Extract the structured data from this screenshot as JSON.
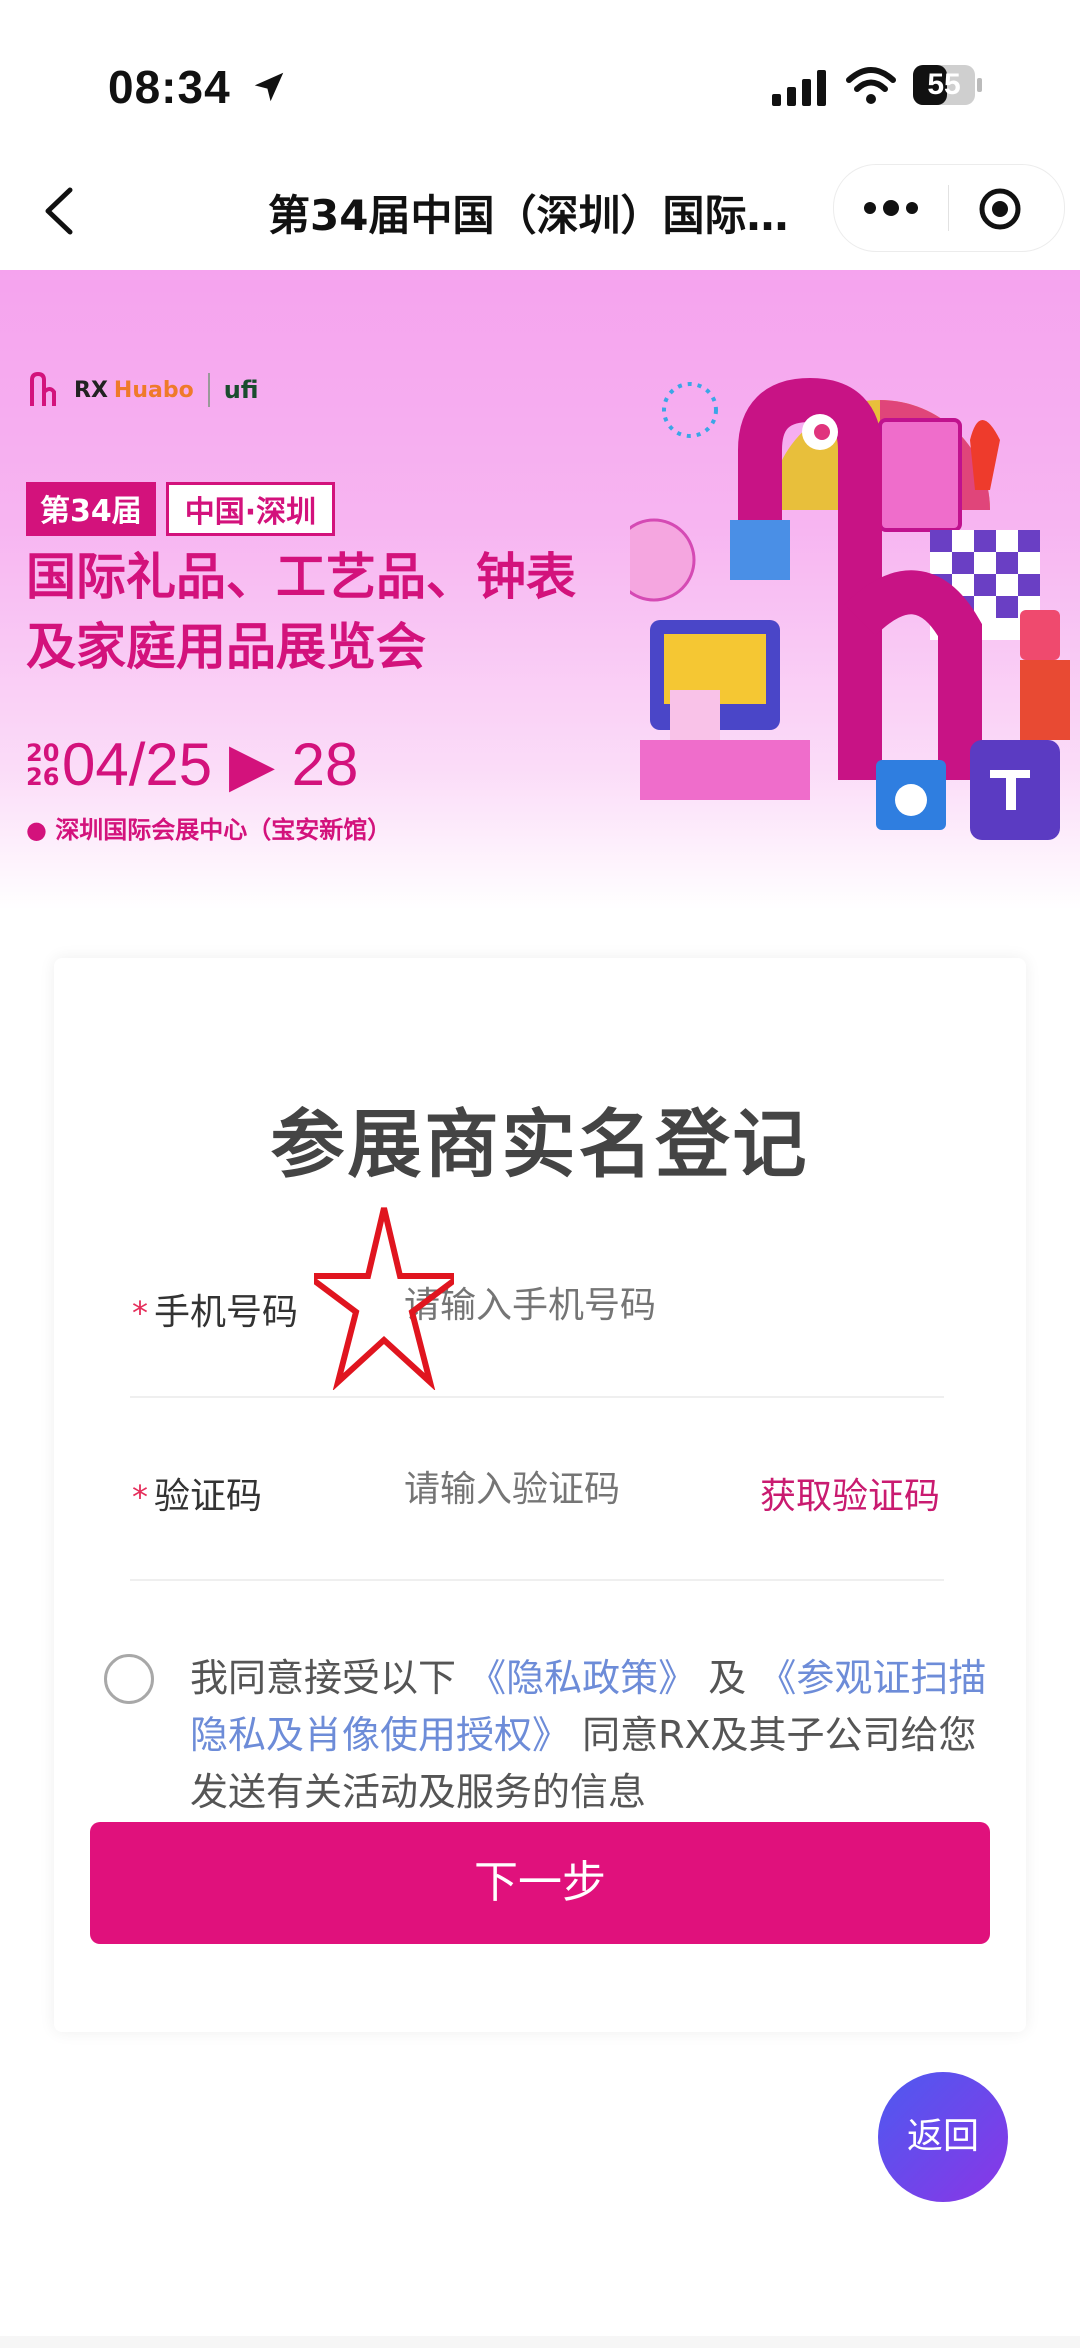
{
  "status_bar": {
    "time": "08:34",
    "battery": "55"
  },
  "nav": {
    "title": "第34届中国（深圳）国际…"
  },
  "banner": {
    "brand": "Huabo",
    "brand_prefix": "RX",
    "partner": "ufi",
    "edition": "第34届",
    "location_tag": "中国·深圳",
    "title_line1": "国际礼品、工艺品、钟表",
    "title_line2": "及家庭用品展览会",
    "year": "20 26",
    "dates": "04/25 ▶ 28",
    "venue": "深圳国际会展中心（宝安新馆）"
  },
  "form": {
    "title": "参展商实名登记",
    "phone_label": "手机号码",
    "phone_placeholder": "请输入手机号码",
    "code_label": "验证码",
    "code_placeholder": "请输入验证码",
    "get_code": "获取验证码",
    "required_mark": "*",
    "agree_prefix": "我同意接受以下",
    "privacy_link": "《隐私政策》",
    "agree_and": "及",
    "auth_link": "《参观证扫描隐私及肖像使用授权》",
    "agree_suffix": "同意RX及其子公司给您发送有关活动及服务的信息",
    "next_button": "下一步"
  },
  "fab": {
    "back": "返回"
  },
  "colors": {
    "accent": "#e0117c",
    "link": "#6d8cd8",
    "fab": "#6a46ea"
  }
}
